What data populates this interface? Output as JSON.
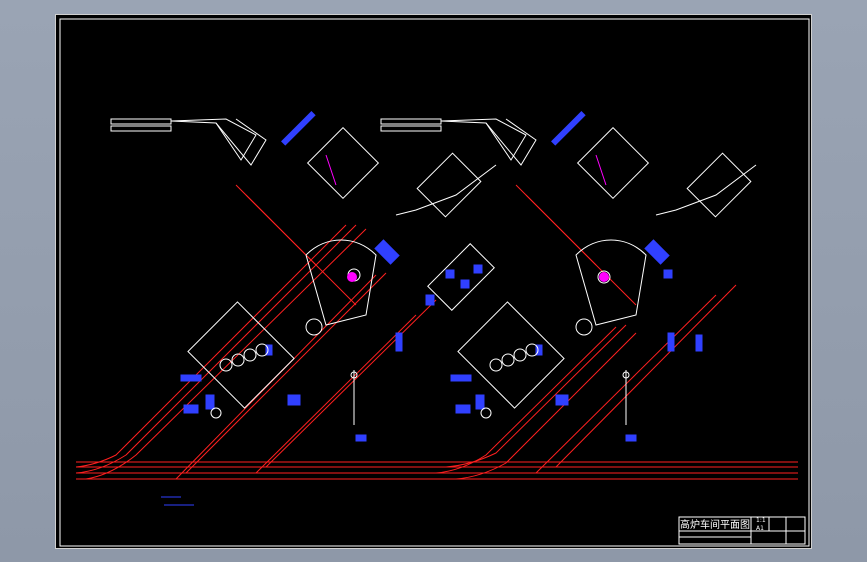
{
  "drawing": {
    "title": "高炉车间平面图",
    "title_block_codes": [
      "1:1",
      "A1"
    ]
  },
  "colors": {
    "background": "#000000",
    "viewport": "#94a0b0",
    "border": "#ffffff",
    "road": "#ff2020",
    "conveyor": "#ffffff",
    "equipment": "#3040ff",
    "highlight": "#ff00ff"
  }
}
